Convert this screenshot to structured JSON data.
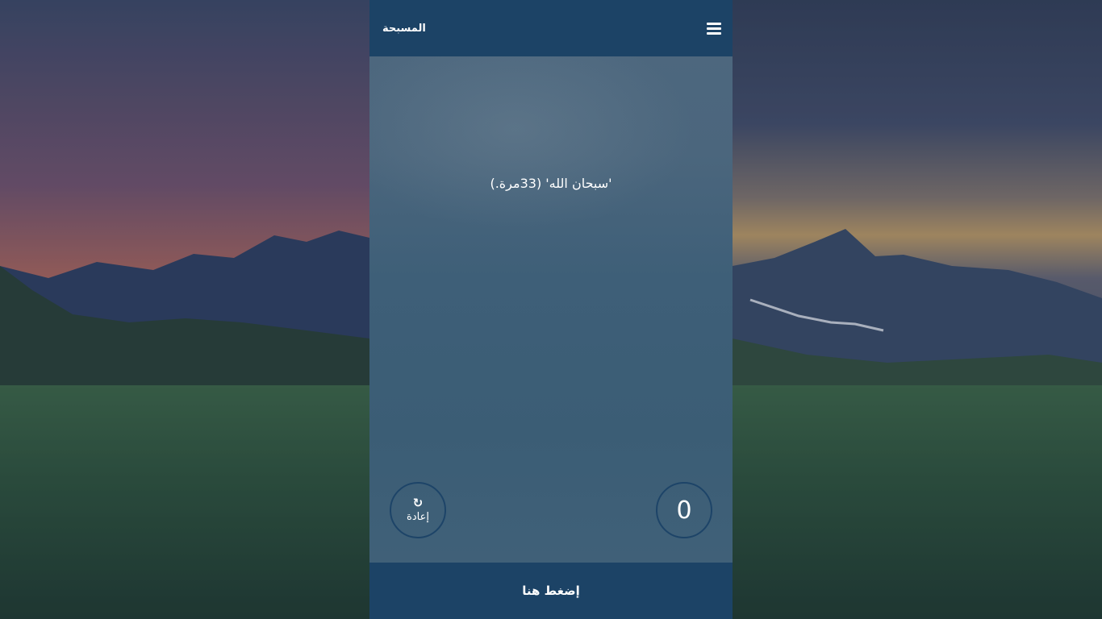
{
  "header": {
    "title": "المسبحة",
    "menu_icon": "hamburger-menu-icon"
  },
  "dhikr": {
    "text": "'سبحان الله' (33مرة.)"
  },
  "reset": {
    "icon": "refresh-icon",
    "icon_glyph": "↻",
    "label": "إعادة"
  },
  "counter": {
    "value": "0"
  },
  "action": {
    "label": "إضغط هنا"
  },
  "colors": {
    "header_bg": "#1c4366",
    "panel_bg": "#4b667d",
    "text": "#ffffff",
    "circle_border": "#1d4468"
  }
}
